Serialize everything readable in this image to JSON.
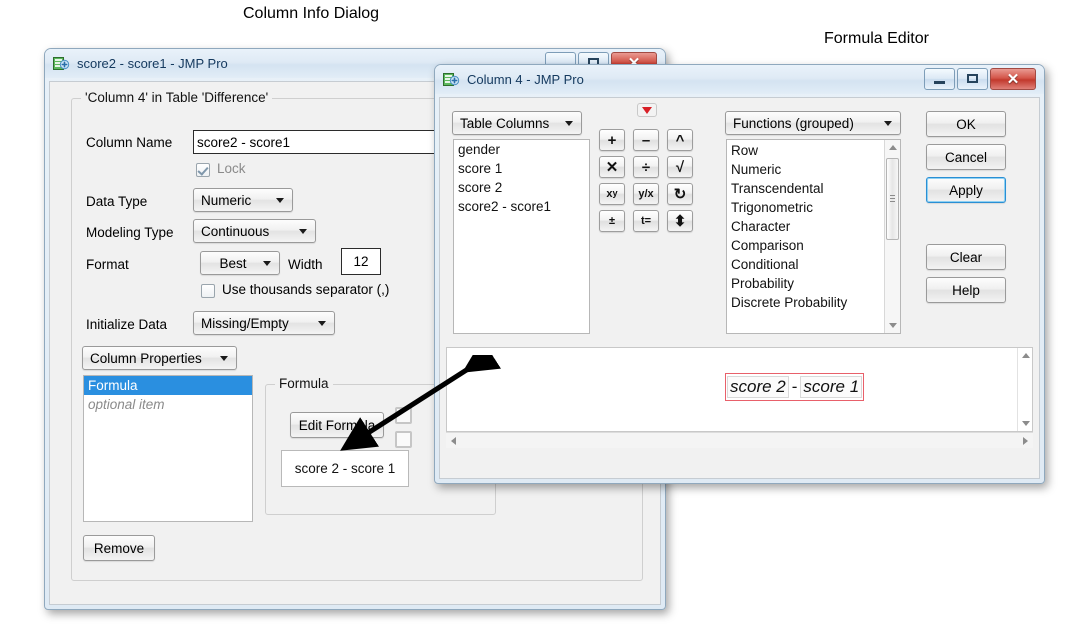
{
  "annotations": {
    "column_info_caption": "Column Info Dialog",
    "formula_editor_caption": "Formula Editor",
    "arrow": "double-headed-arrow"
  },
  "column_info_window": {
    "title": "score2 - score1 - JMP Pro",
    "icon": "jmp-column-icon",
    "group_legend": "'Column 4' in Table 'Difference'",
    "fields": {
      "column_name_label": "Column Name",
      "column_name_value": "score2 - score1",
      "lock_label": "Lock",
      "lock_checked": true,
      "data_type_label": "Data Type",
      "data_type_value": "Numeric",
      "modeling_type_label": "Modeling Type",
      "modeling_type_value": "Continuous",
      "format_label": "Format",
      "format_value": "Best",
      "width_label": "Width",
      "width_value": "12",
      "thousands_label": "Use thousands separator (,)",
      "thousands_checked": false,
      "initialize_label": "Initialize Data",
      "initialize_value": "Missing/Empty"
    },
    "column_properties_button": "Column Properties",
    "properties_list": [
      {
        "label": "Formula",
        "selected": true,
        "italic": false
      },
      {
        "label": "optional item",
        "selected": false,
        "italic": true
      }
    ],
    "formula_group_legend": "Formula",
    "edit_formula_button": "Edit Formula",
    "formula_preview": "score 2 - score 1",
    "remove_button": "Remove"
  },
  "formula_editor_window": {
    "title": "Column 4 - JMP Pro",
    "icon": "jmp-column-icon",
    "window_buttons": [
      {
        "name": "minimize",
        "glyph": "minimize-icon"
      },
      {
        "name": "maximize",
        "glyph": "maximize-icon"
      },
      {
        "name": "close",
        "glyph": "close-icon"
      }
    ],
    "table_columns_dropdown": "Table Columns",
    "table_columns": [
      "gender",
      "score 1",
      "score 2",
      "score2 - score1"
    ],
    "functions_dropdown": "Functions (grouped)",
    "functions": [
      "Row",
      "Numeric",
      "Transcendental",
      "Trigonometric",
      "Character",
      "Comparison",
      "Conditional",
      "Probability",
      "Discrete Probability"
    ],
    "keypad": {
      "red_menu": "red-triangle-menu-icon",
      "keys": [
        {
          "name": "add-key",
          "glyph": "+"
        },
        {
          "name": "subtract-key",
          "glyph": "−"
        },
        {
          "name": "insert-above-key",
          "glyph": "⌃"
        },
        {
          "name": "multiply-key",
          "glyph": "✕"
        },
        {
          "name": "divide-key",
          "glyph": "÷"
        },
        {
          "name": "root-key",
          "glyph": "√"
        },
        {
          "name": "power-key",
          "glyph": "xʸ"
        },
        {
          "name": "reciprocal-key",
          "glyph": "y/x"
        },
        {
          "name": "swap-key",
          "glyph": "↻"
        },
        {
          "name": "sign-key",
          "glyph": "±"
        },
        {
          "name": "local-var-key",
          "glyph": "t="
        },
        {
          "name": "peel-key",
          "glyph": "⬍"
        }
      ]
    },
    "action_buttons": [
      {
        "name": "ok-button",
        "label": "OK",
        "focused": false
      },
      {
        "name": "cancel-button",
        "label": "Cancel",
        "focused": false
      },
      {
        "name": "apply-button",
        "label": "Apply",
        "focused": true
      },
      {
        "name": "clear-button",
        "label": "Clear",
        "focused": false
      },
      {
        "name": "help-button",
        "label": "Help",
        "focused": false
      }
    ],
    "formula_expression": {
      "left_term": "score 2",
      "operator": "-",
      "right_term": "score 1",
      "selection_color": "#e8606a"
    }
  }
}
